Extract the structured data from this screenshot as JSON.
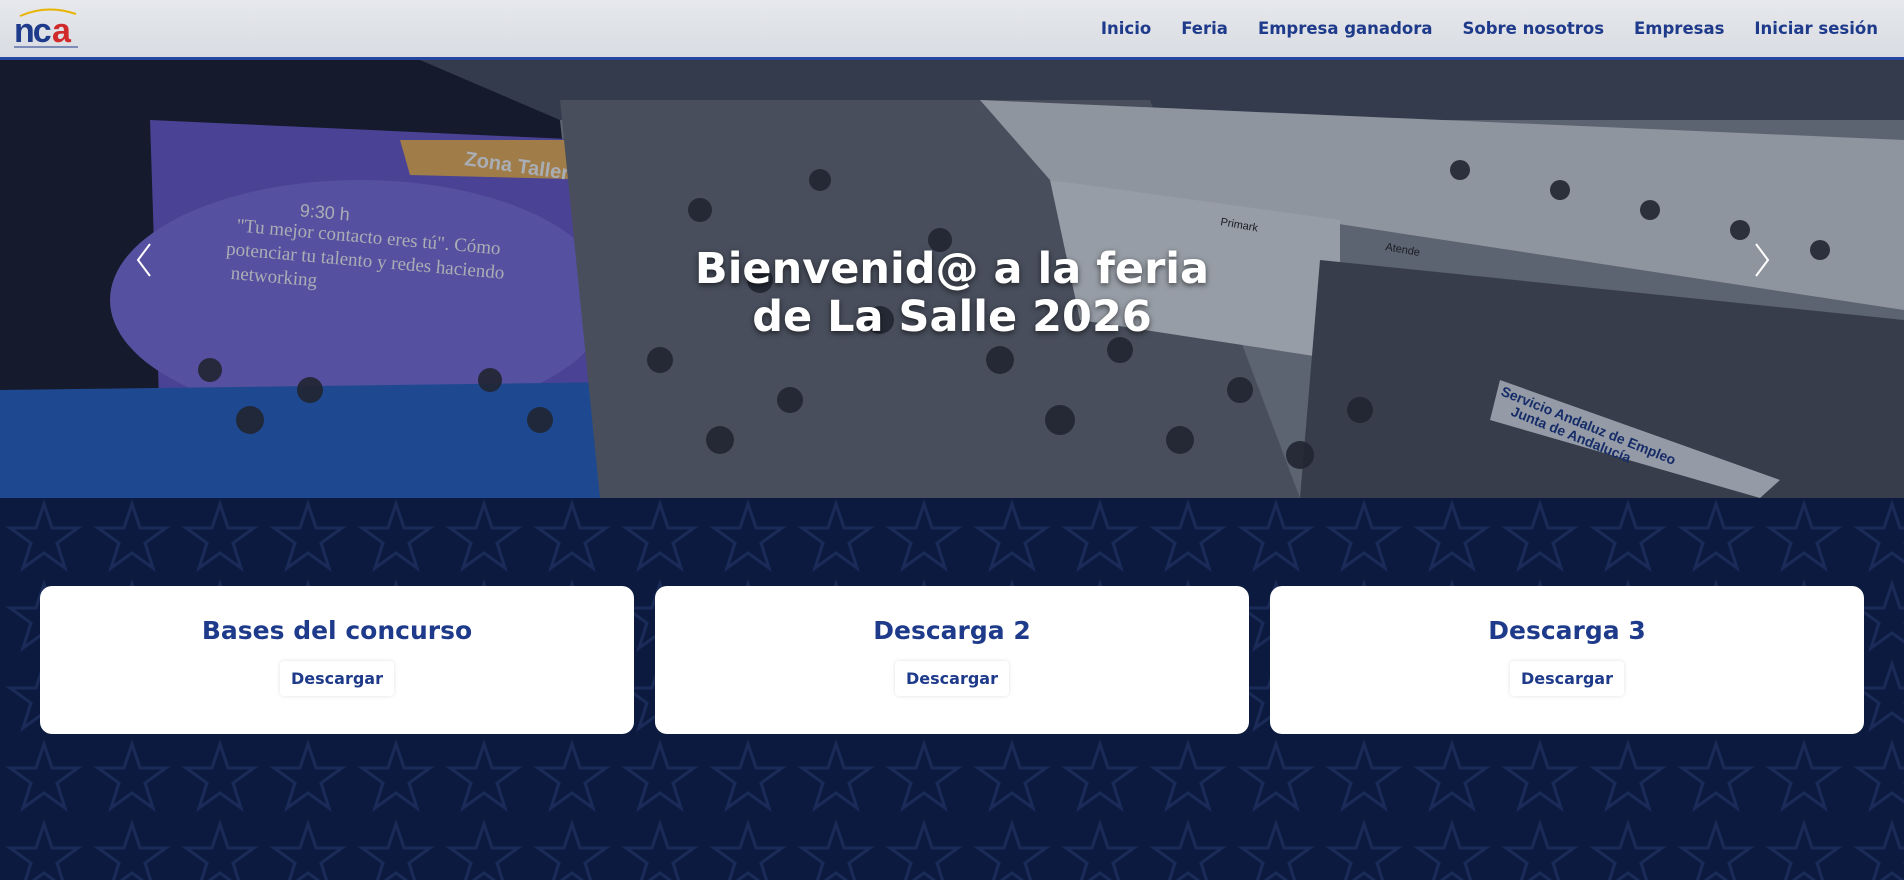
{
  "navbar": {
    "logo_text": "nca",
    "links": [
      "Inicio",
      "Feria",
      "Empresa ganadora",
      "Sobre nosotros",
      "Empresas",
      "Iniciar sesión"
    ]
  },
  "hero": {
    "title_line1": "Bienvenid@ a la feria",
    "title_line2": "de La Salle 2026",
    "photo_texts": {
      "zona": "Zona Talleres",
      "time": "9:30 h",
      "talk_l1": "\"Tu mejor contacto eres tú\". Cómo",
      "talk_l2": "potenciar tu talento y redes haciendo",
      "talk_l3": "networking",
      "stand1": "Primark",
      "stand2": "Atende",
      "banner_l1": "Servicio Andaluz de Empleo",
      "banner_l2": "Junta de Andalucía"
    }
  },
  "downloads": {
    "cards": [
      {
        "title": "Bases del concurso",
        "button": "Descargar"
      },
      {
        "title": "Descarga 2",
        "button": "Descargar"
      },
      {
        "title": "Descarga 3",
        "button": "Descargar"
      }
    ]
  },
  "colors": {
    "accent": "#1e3a8a",
    "navbar_border": "#2446a0",
    "section_bg": "#0b1a3e",
    "card_bg": "#ffffff"
  },
  "icons": {
    "prev": "chevron-left-icon",
    "next": "chevron-right-icon"
  }
}
